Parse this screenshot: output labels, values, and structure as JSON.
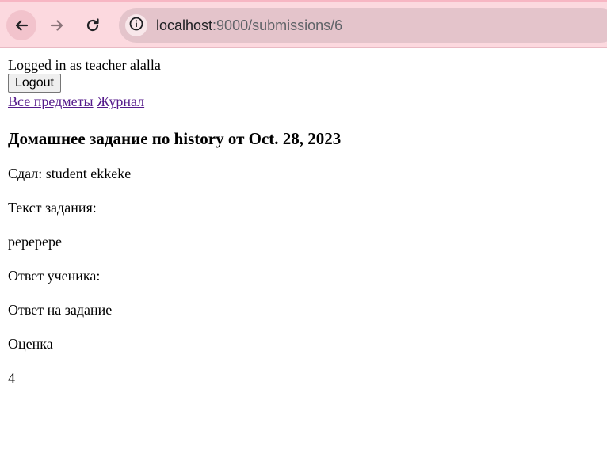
{
  "browser": {
    "url_host": "localhost",
    "url_path": ":9000/submissions/6",
    "icons": {
      "back": "back-arrow-icon",
      "forward": "forward-arrow-icon",
      "reload": "reload-icon",
      "site_info": "info-icon"
    },
    "toolbar_color": "#fcd9df"
  },
  "page": {
    "logged_in_text": "Logged in as teacher alalla",
    "logout_label": "Logout",
    "nav_links": [
      "Все предметы",
      "Журнал"
    ],
    "heading": "Домашнее задание по history от Oct. 28, 2023",
    "submitted_by": "Сдал: student ekkeke",
    "task_label": "Текст задания:",
    "task_text": "реререре",
    "answer_label": "Ответ ученика:",
    "answer_text": "Ответ на задание",
    "grade_label": "Оценка",
    "grade_value": "4",
    "link_color": "#551a8b"
  }
}
